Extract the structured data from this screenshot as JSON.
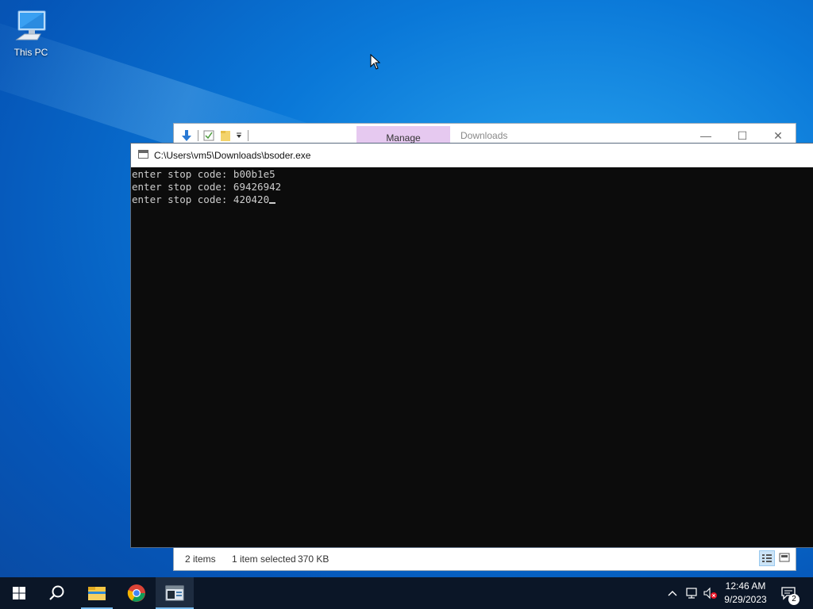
{
  "desktop": {
    "icons": [
      {
        "label": "This PC",
        "icon": "computer-icon"
      }
    ]
  },
  "explorer": {
    "manage_tab": "Manage",
    "title": "Downloads",
    "status": {
      "items": "2 items",
      "selected": "1 item selected",
      "size": "370 KB"
    },
    "icons": [
      "down-arrow-icon",
      "properties-icon",
      "new-folder-icon",
      "chevron-down-icon"
    ]
  },
  "console": {
    "title": "C:\\Users\\vm5\\Downloads\\bsoder.exe",
    "lines": [
      "enter stop code: b00b1e5",
      "enter stop code: 69426942",
      "enter stop code: 420420"
    ]
  },
  "taskbar": {
    "buttons": [
      "start-icon",
      "search-icon",
      "file-explorer-icon",
      "chrome-icon",
      "console-app-icon"
    ],
    "tray": [
      "chevron-up-icon",
      "network-icon",
      "volume-muted-icon"
    ],
    "clock": {
      "time": "12:46 AM",
      "date": "9/29/2023"
    },
    "notification_count": "2"
  },
  "colors": {
    "taskbar_bg": "#0b1627",
    "accent": "#76b9ed",
    "manage_tab": "#e6c9f0",
    "console_bg": "#0c0c0c",
    "console_text": "#cccccc"
  }
}
